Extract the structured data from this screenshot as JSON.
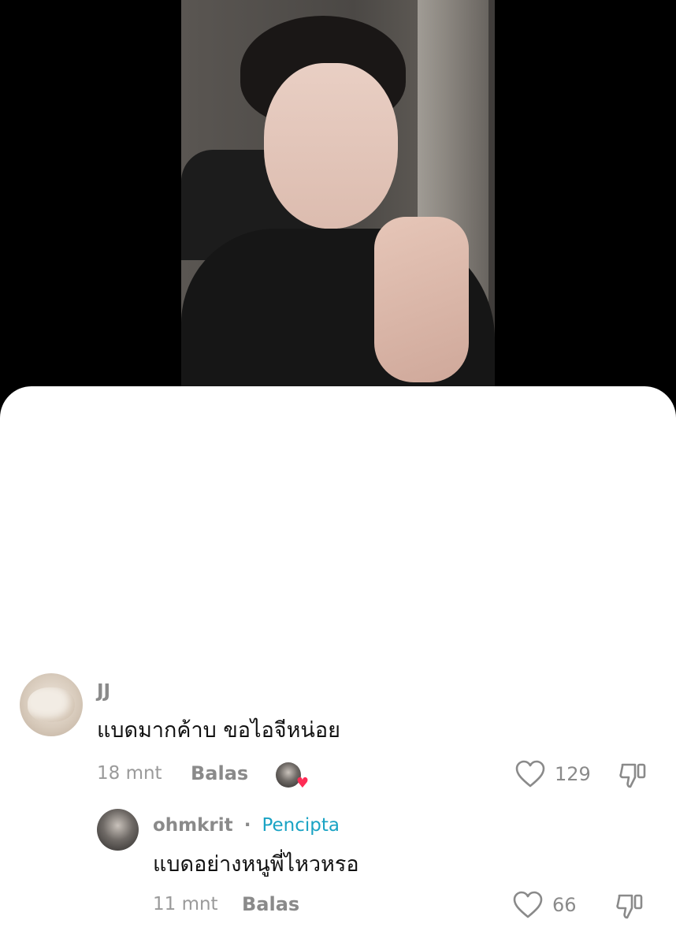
{
  "comments": [
    {
      "username": "JJ",
      "text": "แบดมากค้าบ ขอไอจีหน่อย",
      "time": "18 mnt",
      "reply_label": "Balas",
      "like_count": "129",
      "liked_by_creator": true
    }
  ],
  "reply": {
    "username": "ohmkrit",
    "separator": "·",
    "badge": "Pencipta",
    "text": "แบดอย่างหนูพี่ไหวหรอ",
    "time": "11 mnt",
    "reply_label": "Balas",
    "like_count": "66"
  },
  "icons": {
    "like": "heart-outline-icon",
    "dislike": "thumbs-down-icon",
    "creator_like": "heart-filled-icon"
  },
  "colors": {
    "creator_badge": "#1aa3c4",
    "heart_red": "#fe2c55"
  }
}
